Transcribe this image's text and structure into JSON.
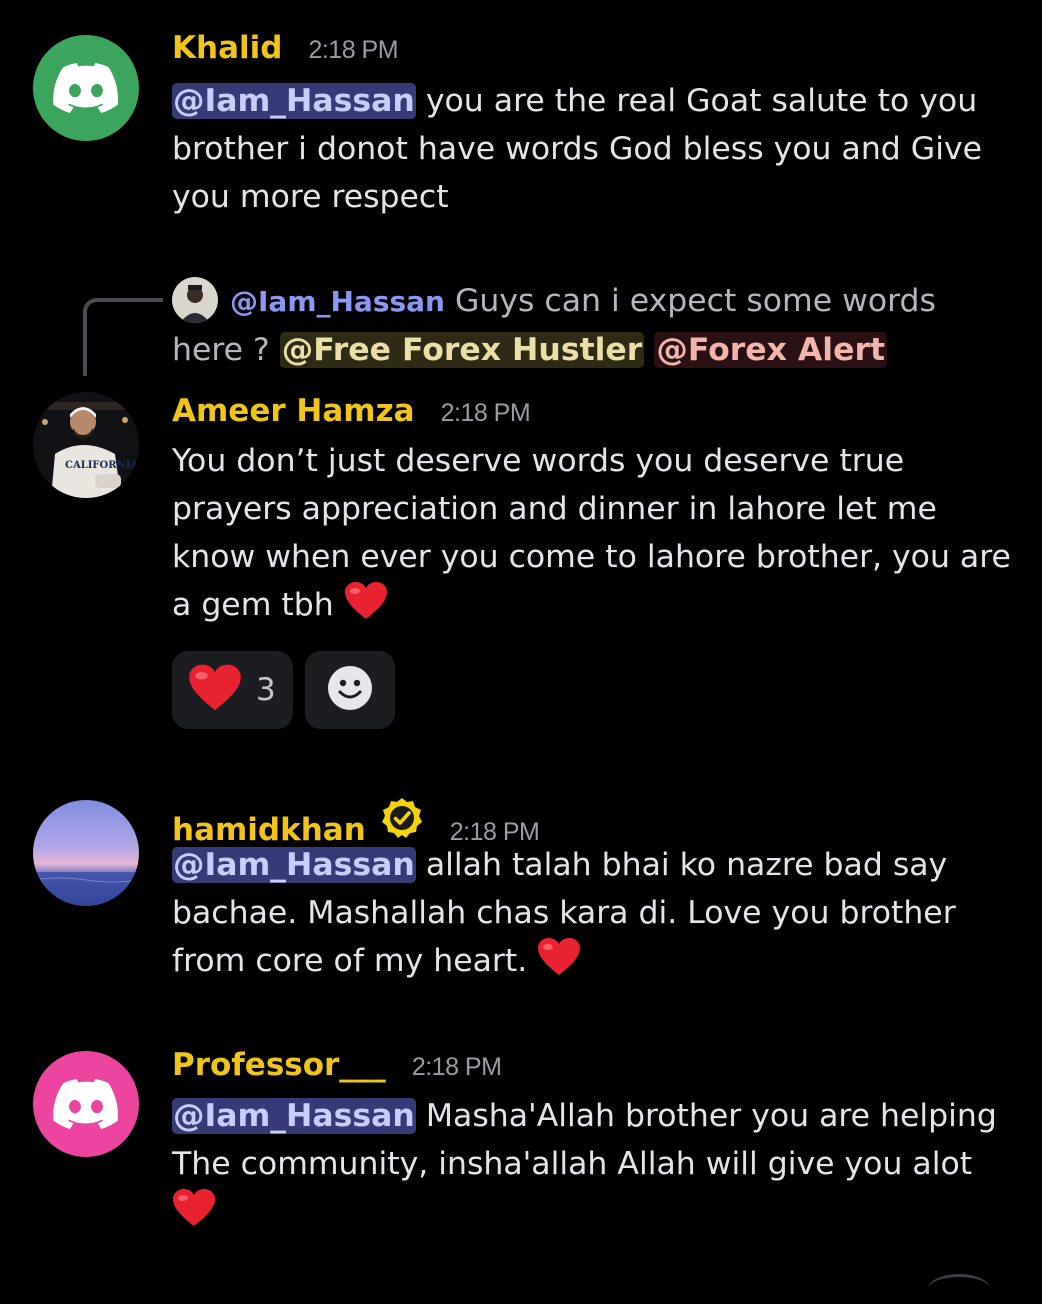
{
  "messages": [
    {
      "username": "Khalid",
      "time": "2:18 PM",
      "avatar_icon": "discord-logo-icon",
      "avatar_color": "#3ba55d",
      "mention": "@Iam_Hassan",
      "text": " you are the real Goat salute to you brother i donot have words God bless you and Give you more respect"
    },
    {
      "reply": {
        "mention": "@Iam_Hassan",
        "text": " Guys can i expect some words here ?  ",
        "role_mention_1": "@Free Forex Hustler",
        "role_mention_2": "@Forex Alert"
      },
      "username": "Ameer Hamza",
      "time": "2:18 PM",
      "text": "You don’t just deserve words you deserve true prayers appreciation and dinner in lahore let me know when ever you come to lahore brother, you are a gem tbh ",
      "reactions": [
        {
          "emoji": "heart-icon",
          "count": "3"
        },
        {
          "emoji": "add-reaction-icon"
        }
      ]
    },
    {
      "username": "hamidkhan",
      "time": "2:18 PM",
      "badge": "verified-badge-icon",
      "mention": "@Iam_Hassan",
      "text": " allah talah bhai ko nazre bad say bachae. Mashallah chas kara di. Love you brother from core of my heart. "
    },
    {
      "username": "Professor___",
      "time": "2:18 PM",
      "avatar_icon": "discord-logo-icon",
      "avatar_color": "#eb459f",
      "mention": "@Iam_Hassan",
      "text": " Masha'Allah brother you are helping The community, insha'allah Allah will give you alot"
    }
  ],
  "colors": {
    "background": "#000000",
    "username": "#f0c419",
    "mention_bg": "#363b78",
    "reply_mention": "#8a98f2"
  }
}
